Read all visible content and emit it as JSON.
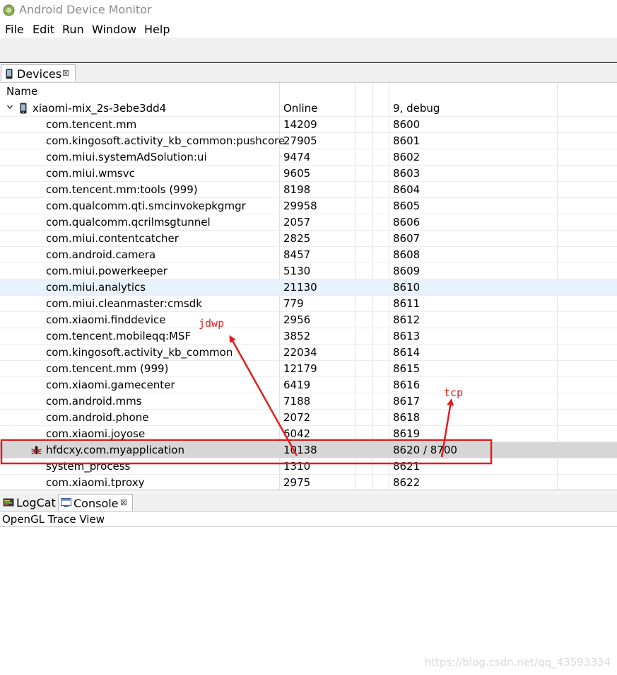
{
  "window": {
    "title": "Android Device Monitor",
    "icon": "android-monitor-icon"
  },
  "menu": [
    "File",
    "Edit",
    "Run",
    "Window",
    "Help"
  ],
  "devices_tab": {
    "label": "Devices",
    "icon": "phone-icon",
    "close": "⊠"
  },
  "table": {
    "headers": {
      "name": "Name"
    },
    "device": {
      "name": "xiaomi-mix_2s-3ebe3dd4",
      "status": "Online",
      "info": "9, debug"
    },
    "rows": [
      {
        "name": "com.tencent.mm",
        "pid": "14209",
        "port": "8600"
      },
      {
        "name": "com.kingosoft.activity_kb_common:pushcore",
        "pid": "27905",
        "port": "8601"
      },
      {
        "name": "com.miui.systemAdSolution:ui",
        "pid": "9474",
        "port": "8602"
      },
      {
        "name": "com.miui.wmsvc",
        "pid": "9605",
        "port": "8603"
      },
      {
        "name": "com.tencent.mm:tools (999)",
        "pid": "8198",
        "port": "8604"
      },
      {
        "name": "com.qualcomm.qti.smcinvokepkgmgr",
        "pid": "29958",
        "port": "8605"
      },
      {
        "name": "com.qualcomm.qcrilmsgtunnel",
        "pid": "2057",
        "port": "8606"
      },
      {
        "name": "com.miui.contentcatcher",
        "pid": "2825",
        "port": "8607"
      },
      {
        "name": "com.android.camera",
        "pid": "8457",
        "port": "8608"
      },
      {
        "name": "com.miui.powerkeeper",
        "pid": "5130",
        "port": "8609"
      },
      {
        "name": "com.miui.analytics",
        "pid": "21130",
        "port": "8610"
      },
      {
        "name": "com.miui.cleanmaster:cmsdk",
        "pid": "779",
        "port": "8611"
      },
      {
        "name": "com.xiaomi.finddevice",
        "pid": "2956",
        "port": "8612"
      },
      {
        "name": "com.tencent.mobileqq:MSF",
        "pid": "3852",
        "port": "8613"
      },
      {
        "name": "com.kingosoft.activity_kb_common",
        "pid": "22034",
        "port": "8614"
      },
      {
        "name": "com.tencent.mm (999)",
        "pid": "12179",
        "port": "8615"
      },
      {
        "name": "com.xiaomi.gamecenter",
        "pid": "6419",
        "port": "8616"
      },
      {
        "name": "com.android.mms",
        "pid": "7188",
        "port": "8617"
      },
      {
        "name": "com.android.phone",
        "pid": "2072",
        "port": "8618"
      },
      {
        "name": "com.xiaomi.joyose",
        "pid": "6042",
        "port": "8619"
      },
      {
        "name": "hfdcxy.com.myapplication",
        "pid": "10138",
        "port": "8620 / 8700"
      },
      {
        "name": "system_process",
        "pid": "1310",
        "port": "8621"
      },
      {
        "name": "com.xiaomi.tproxy",
        "pid": "2975",
        "port": "8622"
      }
    ]
  },
  "bottom_tabs": [
    {
      "label": "LogCat",
      "icon": "logcat-icon"
    },
    {
      "label": "Console",
      "icon": "console-icon",
      "close": "⊠"
    }
  ],
  "opengl_label": "OpenGL Trace View",
  "annotations": {
    "jdwp": "jdwp",
    "tcp": "tcp",
    "color": "#e31d1d"
  },
  "watermark": "https://blog.csdn.net/qq_43593334",
  "colors": {
    "selected_row": "#d6d6d6",
    "hover_row": "#e8f2fc",
    "annotation": "#e31d1d"
  }
}
